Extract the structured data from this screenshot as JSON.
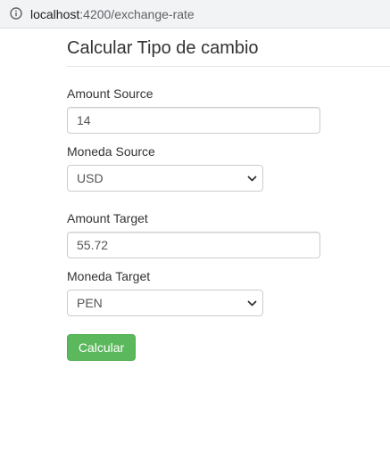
{
  "address_bar": {
    "host": "localhost",
    "path": ":4200/exchange-rate",
    "icon": "info-icon"
  },
  "page": {
    "title": "Calcular Tipo de cambio"
  },
  "form": {
    "amount_source": {
      "label": "Amount Source",
      "value": "14"
    },
    "moneda_source": {
      "label": "Moneda Source",
      "selected": "USD",
      "icon": "chevron-down-icon"
    },
    "amount_target": {
      "label": "Amount Target",
      "value": "55.72"
    },
    "moneda_target": {
      "label": "Moneda Target",
      "selected": "PEN",
      "icon": "chevron-down-icon"
    },
    "submit_label": "Calcular"
  },
  "colors": {
    "button_bg": "#5cb85c",
    "button_border": "#4cae4c",
    "address_bar_bg": "#f1f3f4"
  }
}
